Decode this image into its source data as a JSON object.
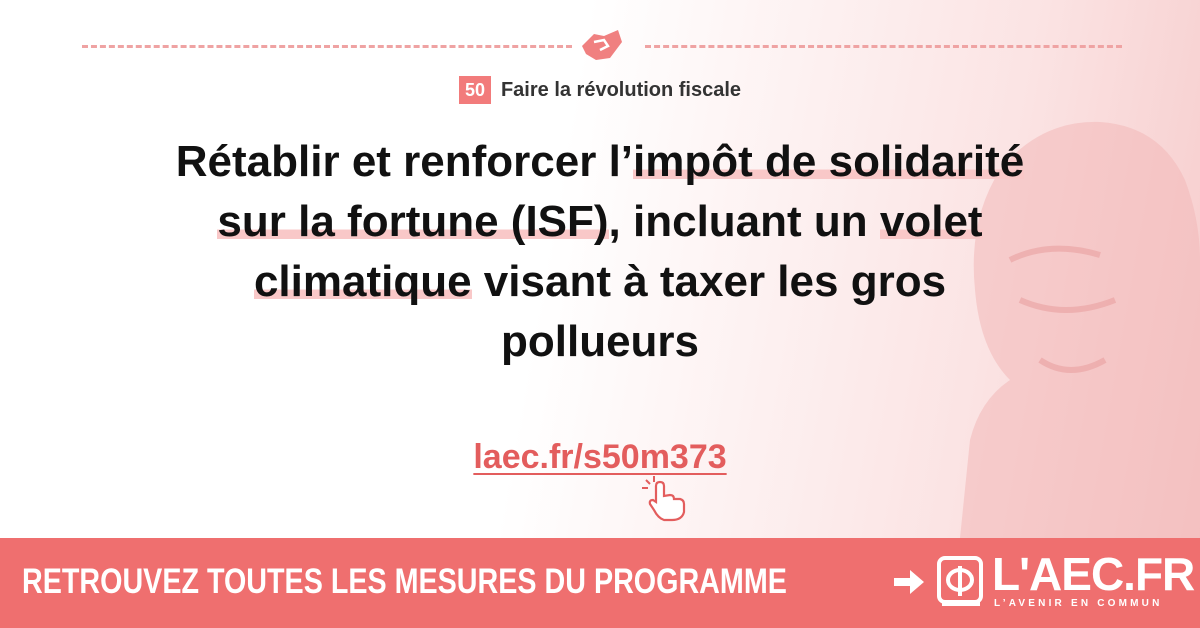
{
  "section": {
    "number": "50",
    "title": "Faire la révolution fiscale"
  },
  "headline": {
    "line1_a": "Rétablir et renforcer l’",
    "line1_b": "impôt de solidarité",
    "line2_a": "sur la fortune (ISF)",
    "line2_b": ", incluant un ",
    "line2_c": "volet",
    "line3_a": "climatique",
    "line3_b": " visant à taxer les gros",
    "line4": "pollueurs"
  },
  "link": "laec.fr/s50m373",
  "banner": {
    "text": "RETROUVEZ TOUTES LES MESURES DU PROGRAMME",
    "logo": "L'AEC.FR",
    "logo_sub": "L’AVENIR EN COMMUN"
  },
  "colors": {
    "accent": "#ef6f6f",
    "highlight": "#f9c8c8",
    "link": "#e35d5d",
    "text": "#111111"
  },
  "icons": [
    "hands-icon",
    "pointer-hand-icon",
    "arrow-right-icon",
    "phi-logo-icon"
  ]
}
